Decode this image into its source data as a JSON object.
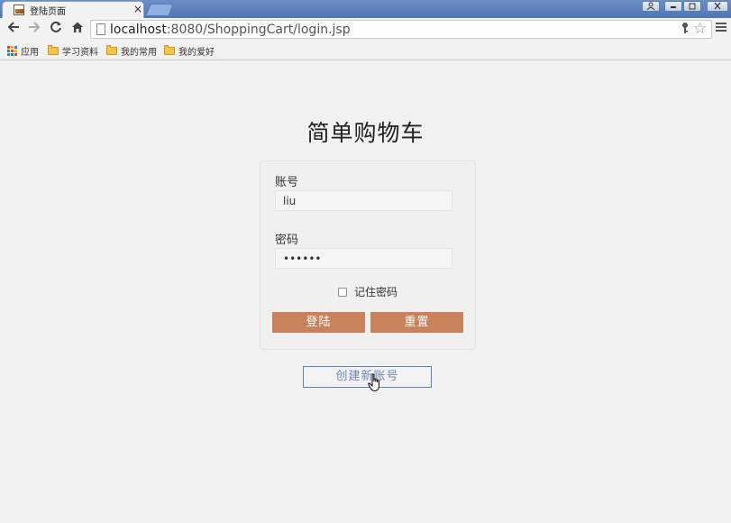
{
  "browser": {
    "tab_title": "登陆页面",
    "tab_close": "×",
    "url_host": "localhost",
    "url_rest": ":8080/ShoppingCart/login.jsp",
    "bookmarks": [
      {
        "label": "应用",
        "icon": "apps-icon"
      },
      {
        "label": "学习资料",
        "icon": "folder-icon"
      },
      {
        "label": "我的常用",
        "icon": "folder-icon"
      },
      {
        "label": "我的爱好",
        "icon": "folder-icon"
      }
    ],
    "window_controls": [
      "user-icon",
      "minimize-icon",
      "restore-icon",
      "close-icon"
    ]
  },
  "page": {
    "title": "简单购物车",
    "form": {
      "account_label": "账号",
      "account_value": "liu",
      "password_label": "密码",
      "password_value": "123456",
      "remember_label": "记住密码",
      "remember_checked": false,
      "login_button": "登陆",
      "reset_button": "重置"
    },
    "create_account_button": "创建新账号"
  },
  "colors": {
    "button_bg": "#c9825a",
    "link_border": "#5b7fc0",
    "page_bg": "#f1f1f1"
  }
}
